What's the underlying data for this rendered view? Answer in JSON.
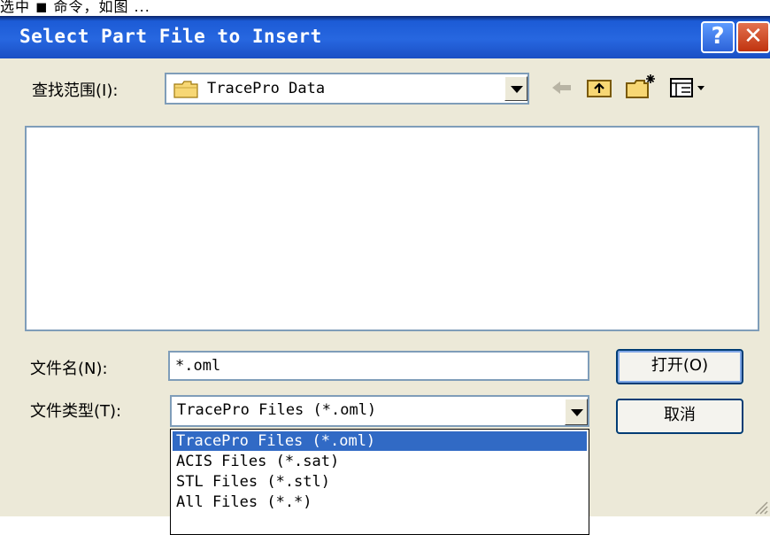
{
  "background_doc": {
    "text": "选中 ◼ 命令，如图 ..."
  },
  "dialog": {
    "title": "Select Part File to Insert",
    "help_label": "?",
    "close_label": "✕"
  },
  "look_in": {
    "label": "查找范围(I):",
    "value": "TracePro Data"
  },
  "toolbar": {
    "back_icon": "back-arrow-icon",
    "up_icon": "up-folder-icon",
    "new_folder_icon": "new-folder-icon",
    "view_icon": "view-menu-icon"
  },
  "file_name": {
    "label": "文件名(N):",
    "value": "*.oml"
  },
  "file_type": {
    "label": "文件类型(T):",
    "value": "TracePro Files (*.oml)",
    "options": [
      "TracePro Files (*.oml)",
      "ACIS Files (*.sat)",
      "STL Files (*.stl)",
      "All Files (*.*)"
    ],
    "highlighted_index": 0
  },
  "buttons": {
    "open_label": "打开(O)",
    "cancel_label": "取消"
  },
  "colors": {
    "title_bar": "#2767e0",
    "dialog_bg": "#ece9d8",
    "selection": "#316ac5",
    "border": "#7f9db9"
  }
}
